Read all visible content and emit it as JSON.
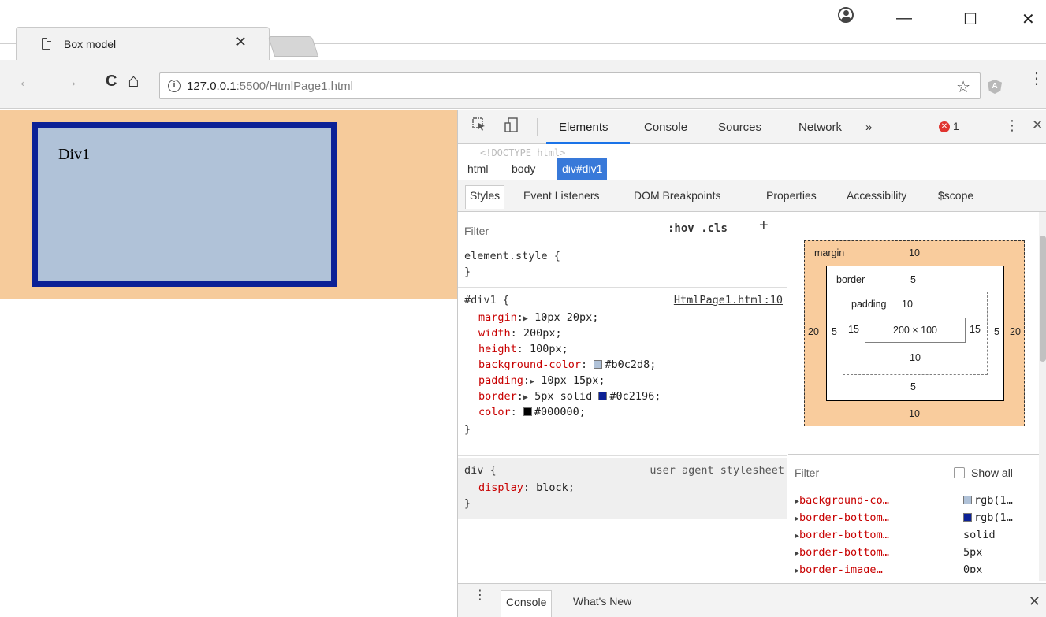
{
  "browser": {
    "tab_title": "Box model",
    "tab_close": "✕",
    "url_host": "127.0.0.1",
    "url_rest": ":5500/HtmlPage1.html",
    "window_minimize": "—",
    "window_maximize": "☐",
    "window_close": "✕",
    "back": "←",
    "forward": "→",
    "reload": "C",
    "home": "⌂",
    "info": "i",
    "star": "☆",
    "extension_letter": "A",
    "menu": "⋮"
  },
  "page": {
    "div_text": "Div1",
    "div_background": "#b0c2d8",
    "div_border_color": "#0c2196",
    "body_highlight": "#f6cb9b"
  },
  "devtools": {
    "main_tabs": [
      "Elements",
      "Console",
      "Sources",
      "Network"
    ],
    "more_tabs": "»",
    "error_count": "1",
    "menu": "⋮",
    "close": "✕",
    "dom_peek": "<!DOCTYPE html>",
    "breadcrumbs": [
      "html",
      "body",
      "div#div1"
    ],
    "sub_tabs": [
      "Styles",
      "Event Listeners",
      "DOM Breakpoints",
      "Properties",
      "Accessibility",
      "$scope"
    ],
    "styles": {
      "filter_placeholder": "Filter",
      "hov": ":hov",
      "cls": ".cls",
      "add": "+",
      "element_style_open": "element.style {",
      "close_brace": "}",
      "div1_selector": "#div1 {",
      "div1_source": "HtmlPage1.html:10",
      "div1_props": [
        {
          "name": "margin",
          "value": "10px 20px;",
          "expandable": true
        },
        {
          "name": "width",
          "value": "200px;"
        },
        {
          "name": "height",
          "value": "100px;"
        },
        {
          "name": "background-color",
          "value": "#b0c2d8;",
          "swatch": "#b0c2d8"
        },
        {
          "name": "padding",
          "value": "10px 15px;",
          "expandable": true
        },
        {
          "name": "border",
          "value": "5px solid",
          "expandable": true,
          "swatch": "#0c2196",
          "value2": "#0c2196;"
        },
        {
          "name": "color",
          "value": "#000000;",
          "swatch": "#000000"
        }
      ],
      "ua_selector": "div {",
      "ua_source": "user agent stylesheet",
      "ua_prop_name": "display",
      "ua_prop_value": "block;"
    },
    "box_model": {
      "margin_label": "margin",
      "margin_top": "10",
      "margin_bottom": "10",
      "margin_left": "20",
      "margin_right": "20",
      "border_label": "border",
      "border_top": "5",
      "border_bottom": "5",
      "border_left": "5",
      "border_right": "5",
      "padding_label": "padding",
      "padding_top": "10",
      "padding_bottom": "10",
      "padding_left": "15",
      "padding_right": "15",
      "content": "200 × 100"
    },
    "computed": {
      "filter_placeholder": "Filter",
      "show_all": "Show all",
      "rows": [
        {
          "name": "background-co…",
          "value": "rgb(1…",
          "swatch": "#b0c2d8"
        },
        {
          "name": "border-bottom…",
          "value": "rgb(1…",
          "swatch": "#0c2196"
        },
        {
          "name": "border-bottom…",
          "value": "solid"
        },
        {
          "name": "border-bottom…",
          "value": "5px"
        },
        {
          "name": "border-image…",
          "value": "0px"
        }
      ]
    },
    "drawer": {
      "tabs": [
        "Console",
        "What's New"
      ],
      "close": "✕"
    }
  }
}
